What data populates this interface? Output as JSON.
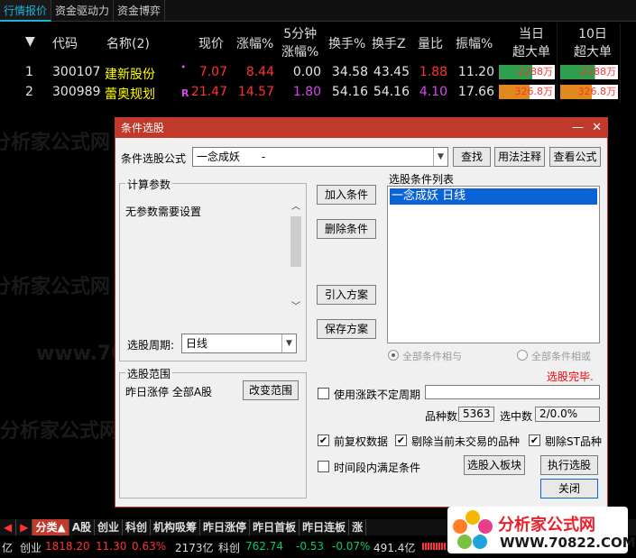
{
  "top_tabs": [
    "行情报价",
    "资金驱动力",
    "资金博弈"
  ],
  "headers": {
    "code": "代码",
    "name": "名称(2)",
    "price": "现价",
    "change_pct": "涨幅%",
    "five_min_l1": "5分钟",
    "five_min_l2": "涨幅%",
    "turnover": "换手%",
    "turnover_z": "换手Z",
    "volume_ratio": "量比",
    "amplitude": "振幅%",
    "today_l1": "当日",
    "today_l2": "超大单",
    "ten_day_l1": "10日",
    "ten_day_l2": "超大单"
  },
  "rows": [
    {
      "idx": "1",
      "code": "300107",
      "name": "建新股份",
      "flag": "•",
      "price": "7.07",
      "change": "8.44",
      "five": "0.00",
      "turnover": "34.58",
      "turnover_z": "43.45",
      "vol_ratio": "1.88",
      "amplitude": "11.20",
      "today": "-2288万",
      "ten": "-2288万",
      "today_pct": 0.6,
      "ten_pct": 0.6,
      "bar_color": "#2e9e4f"
    },
    {
      "idx": "2",
      "code": "300989",
      "name": "蕾奥规划",
      "flag": "R",
      "price": "21.47",
      "change": "14.57",
      "five": "1.80",
      "turnover": "54.16",
      "turnover_z": "54.16",
      "vol_ratio": "4.10",
      "amplitude": "17.66",
      "today": "326.8万",
      "ten": "326.8万",
      "today_pct": 0.55,
      "ten_pct": 0.55,
      "bar_color": "#e08a1e"
    }
  ],
  "dialog": {
    "title": "条件选股",
    "formula_label": "条件选股公式",
    "formula_value": "一念成妖　　-",
    "btn_find": "查找",
    "btn_usage": "用法注释",
    "btn_view": "查看公式",
    "params_title": "计算参数",
    "params_text": "无参数需要设置",
    "period_label": "选股周期:",
    "period_value": "日线",
    "btn_add": "加入条件",
    "btn_delete": "删除条件",
    "btn_import": "引入方案",
    "btn_save": "保存方案",
    "list_title": "选股条件列表",
    "list_items": [
      "一念成妖  日线"
    ],
    "radio_and": "全部条件相与",
    "radio_or": "全部条件相或",
    "status_text": "选股完毕.",
    "range_title": "选股范围",
    "range_text": "昨日涨停 全部A股",
    "btn_change_range": "改变范围",
    "use_period_label": "使用涨跌不定周期",
    "count_label": "品种数",
    "count_value": "5363",
    "selected_label": "选中数",
    "selected_value": "2/0.0%",
    "cb_prefq": "前复权数据",
    "cb_remove_notrade": "剔除当前未交易的品种",
    "cb_remove_st": "剔除ST品种",
    "cb_timerange": "时间段内满足条件",
    "btn_to_block": "选股入板块",
    "btn_execute": "执行选股",
    "btn_close": "关闭"
  },
  "bottom_tabs": [
    "分类▲",
    "A股",
    "创业",
    "科创",
    "机构吸筹",
    "昨日涨停",
    "昨日首板",
    "昨日连板",
    "涨"
  ],
  "status": {
    "s0": "亿",
    "s1_name": "创业",
    "s1_val": "1818.20",
    "s1_chg": "11.30",
    "s1_pct": "0.63%",
    "s1_amt": "2173亿",
    "s2_name": "科创",
    "s2_val": "762.74",
    "s2_chg": "-0.53",
    "s2_pct": "-0.07%",
    "s2_amt": "491.4亿"
  },
  "watermarks": [
    "分析家公式网",
    "www.70822.com"
  ],
  "logo": {
    "title": "分析家公式网",
    "url": "WWW.70822.COM"
  },
  "colors": {
    "accent": "#1bb6d6",
    "up": "#ff3333",
    "down": "#00cc66",
    "dialog_title": "#c0392b"
  }
}
